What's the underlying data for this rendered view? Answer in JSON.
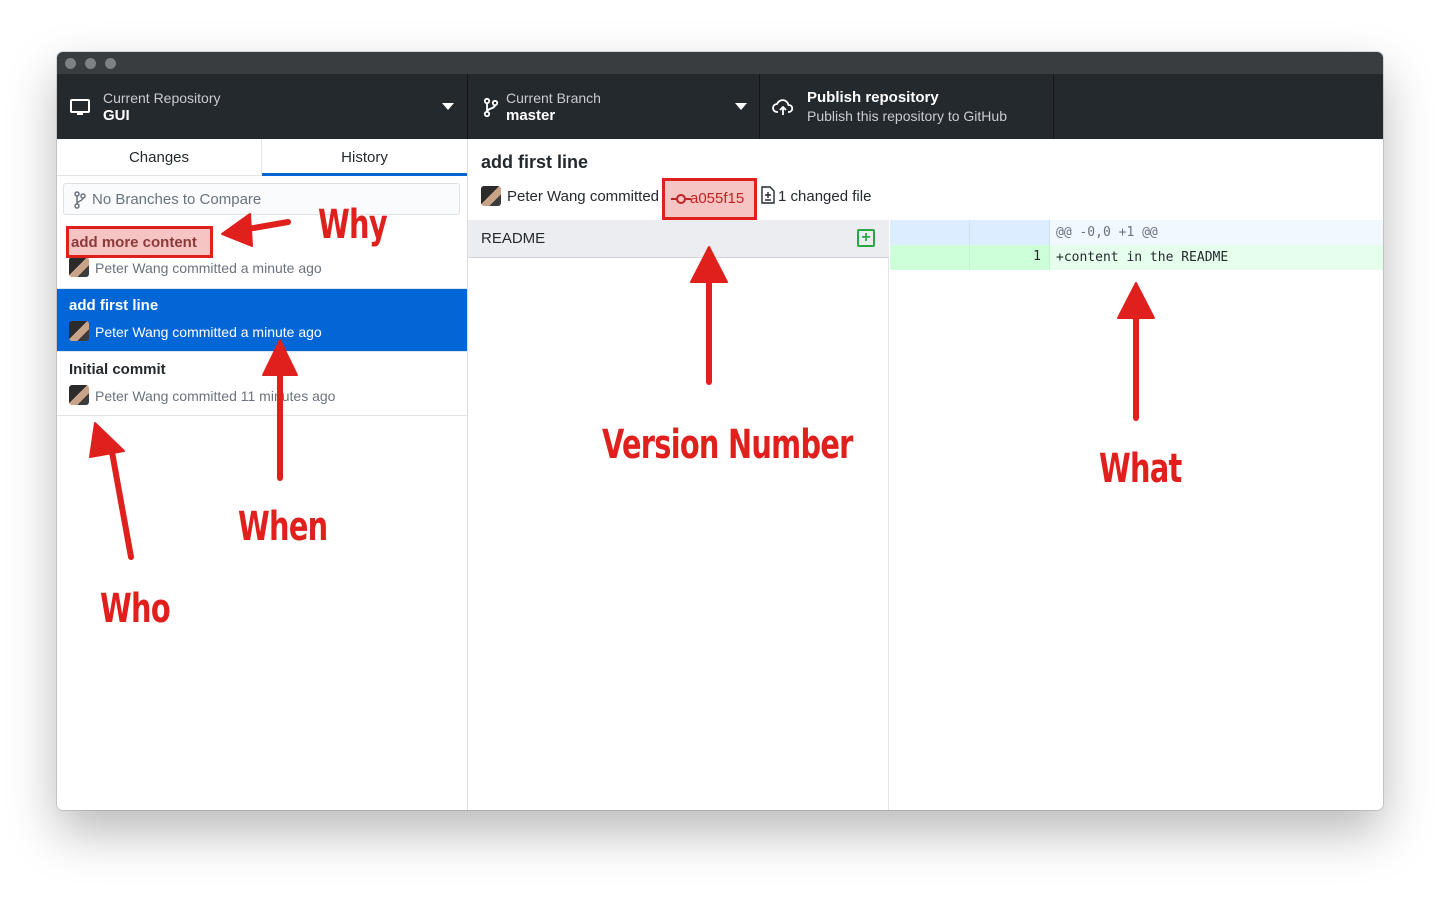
{
  "toolbar": {
    "repo": {
      "label": "Current Repository",
      "value": "GUI",
      "icon": "desktop-icon"
    },
    "branch": {
      "label": "Current Branch",
      "value": "master",
      "icon": "git-branch-icon"
    },
    "publish": {
      "title": "Publish repository",
      "subtitle": "Publish this repository to GitHub",
      "icon": "cloud-upload-icon"
    }
  },
  "sidebar": {
    "tabs": [
      {
        "label": "Changes",
        "active": false
      },
      {
        "label": "History",
        "active": true
      }
    ],
    "compare_placeholder": "No Branches to Compare",
    "commits": [
      {
        "title": "add more content",
        "meta": "Peter Wang committed a minute ago",
        "selected": false
      },
      {
        "title": "add first line",
        "meta": "Peter Wang committed a minute ago",
        "selected": true
      },
      {
        "title": "Initial commit",
        "meta": "Peter Wang committed 11 minutes ago",
        "selected": false
      }
    ]
  },
  "main": {
    "commit_title": "add first line",
    "author_text": "Peter Wang committed",
    "sha": "a055f15",
    "changed_files": "1 changed file",
    "files": [
      {
        "name": "README",
        "status": "added"
      }
    ],
    "diff": {
      "hunk_header": "@@ -0,0 +1 @@",
      "lines": [
        {
          "new_line_no": "1",
          "text": "+content in the README",
          "type": "added"
        }
      ]
    }
  },
  "annotations": {
    "why": "Why",
    "who": "Who",
    "when": "When",
    "version": "Version Number",
    "what": "What"
  },
  "colors": {
    "toolbar_bg": "#24292e",
    "accent_blue": "#0366d6",
    "annotation_red": "#e0201d",
    "diff_added_bg": "#e6ffed"
  }
}
